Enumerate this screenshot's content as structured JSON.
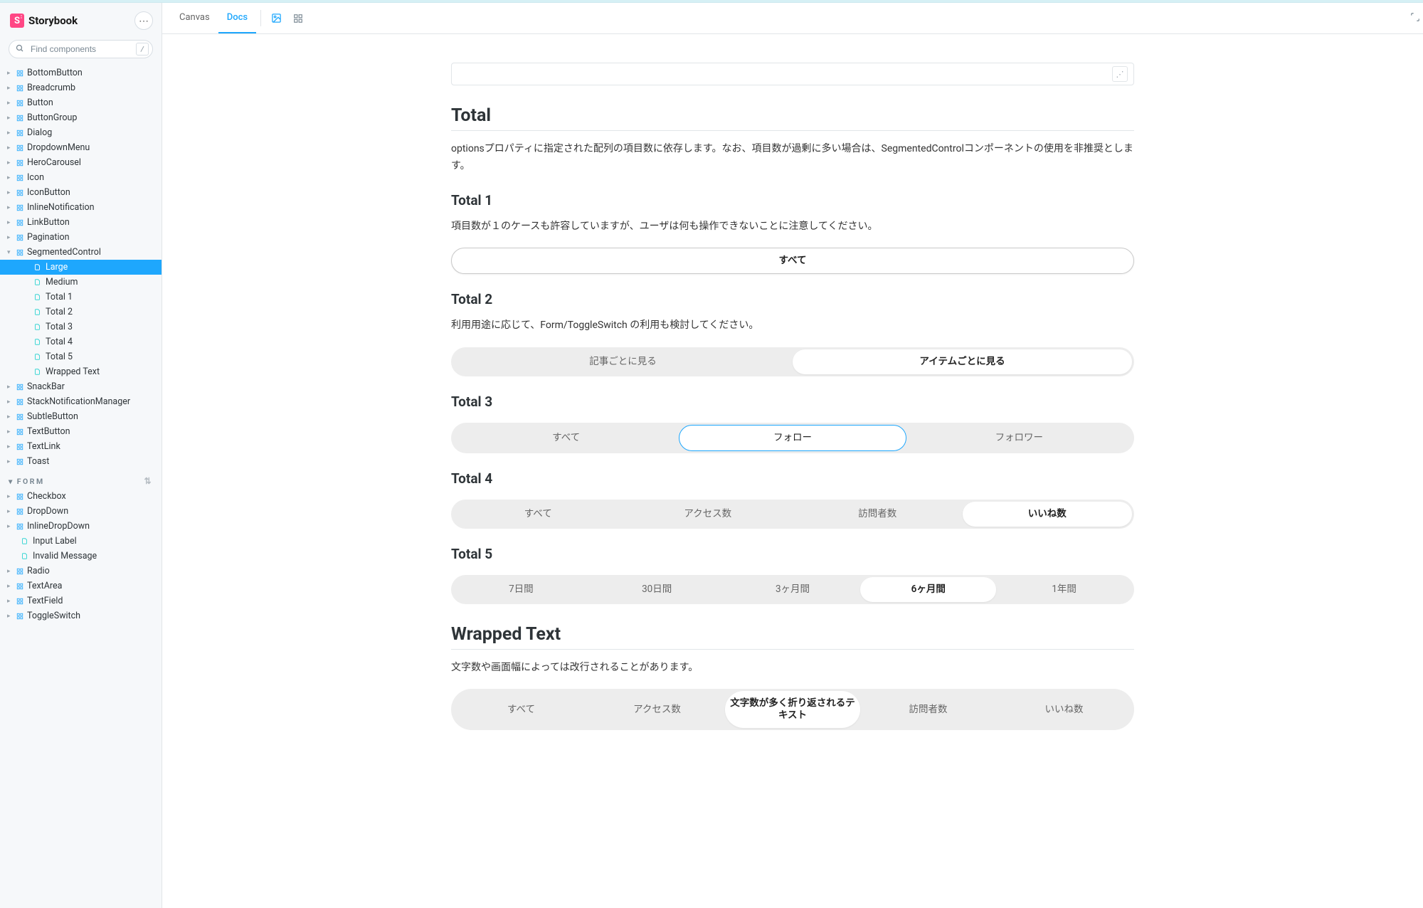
{
  "app": {
    "name": "Storybook",
    "logo_letter": "S"
  },
  "search": {
    "placeholder": "Find components",
    "shortcut": "/"
  },
  "toolbar": {
    "tabs": [
      {
        "label": "Canvas"
      },
      {
        "label": "Docs"
      }
    ]
  },
  "sidebar": {
    "components": [
      "BottomButton",
      "Breadcrumb",
      "Button",
      "ButtonGroup",
      "Dialog",
      "DropdownMenu",
      "HeroCarousel",
      "Icon",
      "IconButton",
      "InlineNotification",
      "LinkButton",
      "Pagination"
    ],
    "expanded": {
      "name": "SegmentedControl",
      "stories": [
        "Large",
        "Medium",
        "Total 1",
        "Total 2",
        "Total 3",
        "Total 4",
        "Total 5",
        "Wrapped Text"
      ],
      "selected": "Large"
    },
    "components_after": [
      "SnackBar",
      "StackNotificationManager",
      "SubtleButton",
      "TextButton",
      "TextLink",
      "Toast"
    ],
    "form_group": {
      "label": "FORM",
      "items": [
        "Checkbox",
        "DropDown",
        "InlineDropDown",
        "Input Label",
        "Invalid Message",
        "Radio",
        "TextArea",
        "TextField",
        "ToggleSwitch"
      ]
    }
  },
  "doc": {
    "total": {
      "heading": "Total",
      "desc": "optionsプロパティに指定された配列の項目数に依存します。なお、項目数が過剰に多い場合は、SegmentedControlコンポーネントの使用を非推奨とします。"
    },
    "sections": [
      {
        "heading": "Total 1",
        "desc": "項目数が１のケースも許容していますが、ユーザは何も操作できないことに注意してください。",
        "variant": "single",
        "options": [
          "すべて"
        ],
        "active": 0
      },
      {
        "heading": "Total 2",
        "desc": "利用用途に応じて、Form/ToggleSwitch の利用も検討してください。",
        "options": [
          "記事ごとに見る",
          "アイテムごとに見る"
        ],
        "active": 1
      },
      {
        "heading": "Total 3",
        "options": [
          "すべて",
          "フォロー",
          "フォロワー"
        ],
        "active": 1,
        "outlined": true
      },
      {
        "heading": "Total 4",
        "options": [
          "すべて",
          "アクセス数",
          "訪問者数",
          "いいね数"
        ],
        "active": 3
      },
      {
        "heading": "Total 5",
        "options": [
          "7日間",
          "30日間",
          "3ヶ月間",
          "6ヶ月間",
          "1年間"
        ],
        "active": 3
      },
      {
        "heading": "Wrapped Text",
        "desc": "文字数や画面幅によっては改行されることがあります。",
        "headingBig": true,
        "options": [
          "すべて",
          "アクセス数",
          "文字数が多く折り返されるテキスト",
          "訪問者数",
          "いいね数"
        ],
        "active": 2,
        "wrap": true
      }
    ]
  }
}
